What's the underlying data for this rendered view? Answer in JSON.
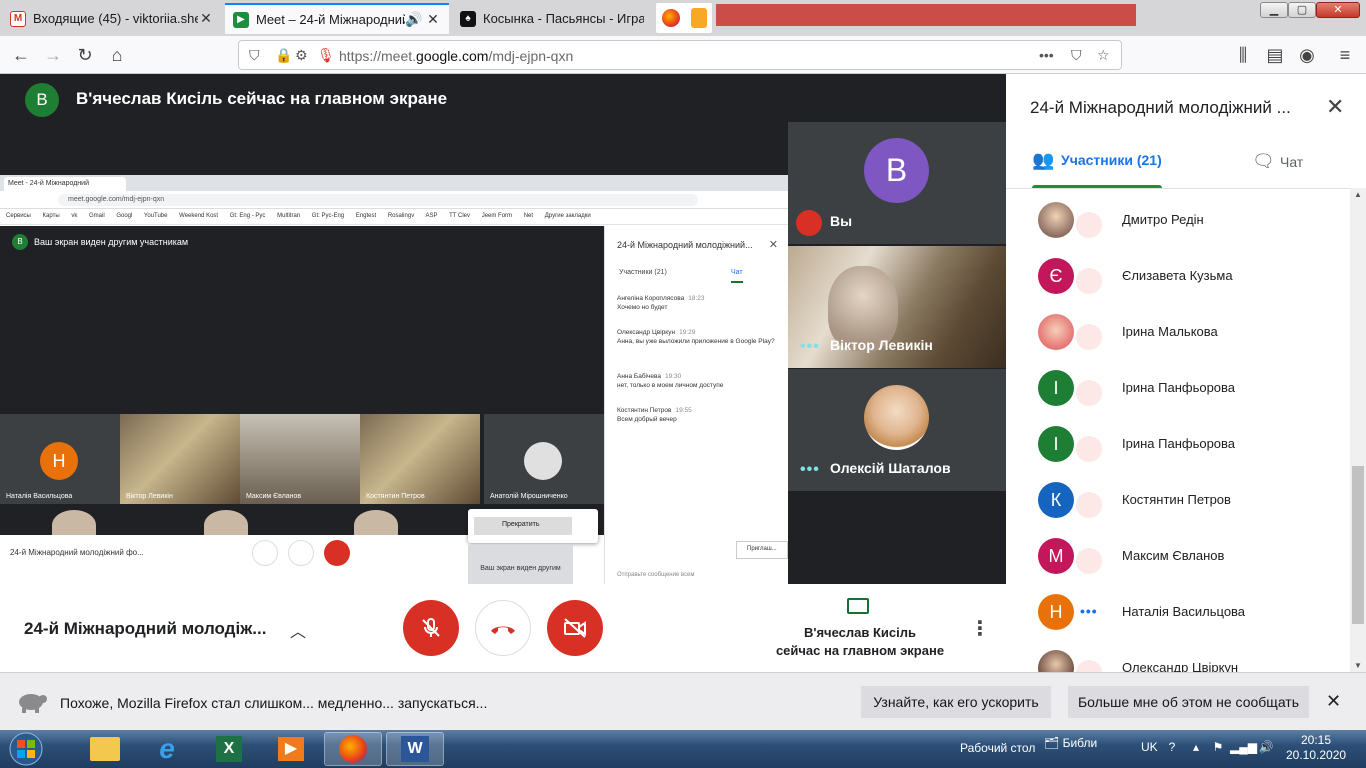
{
  "browser": {
    "tabs": [
      {
        "title": "Входящие (45) - viktoriia.shekh",
        "icon": "gmail-icon",
        "active": false
      },
      {
        "title": "Meet – 24-й Міжнародний",
        "icon": "meet-icon",
        "active": true
      },
      {
        "title": "Косынка - Пасьянсы - Играе",
        "icon": "solitaire-icon",
        "active": false
      }
    ],
    "url_prefix": "https://meet.",
    "url_domain": "google.com",
    "url_path": "/mdj-ejpn-qxn",
    "window_controls": [
      "minimize-icon",
      "maximize-icon",
      "close-icon"
    ]
  },
  "stage": {
    "banner_avatar": "В",
    "banner_text": "В'ячеслав Кисіль сейчас на главном экране"
  },
  "presentation": {
    "tab_title": "Meet - 24-й Міжнародний",
    "url": "meet.google.com/mdj-ejpn-qxn",
    "bookmarks": [
      "Сервисы",
      "Карты",
      "vk",
      "Gmail",
      "Googl",
      "YouTube",
      "Weekend Kost",
      "Gt: Eng - Pyc",
      "Multitran",
      "Gt: Pyc-Eng",
      "Engtest",
      "Rosalingv",
      "ASP",
      "TT Сlev",
      "Jeem Form",
      "Net",
      "Другие закладки"
    ],
    "shared_banner": "Ваш экран виден другим участникам",
    "tiles": [
      {
        "name": "Наталія Васильцова",
        "avatar": "Н"
      },
      {
        "name": "Віктор Левикін",
        "avatar": ""
      },
      {
        "name": "Максим Євланов",
        "avatar": ""
      },
      {
        "name": "Костянтин Петров",
        "avatar": ""
      },
      {
        "name": "Анатолій Мірошниченко",
        "avatar": ""
      }
    ],
    "bottom_title": "24-й Міжнародний молодіжний фо...",
    "stop_label": "Прекратить",
    "shown_label": "Ваш экран виден другим",
    "side_title": "24-й Міжнародний молодіжний...",
    "side_tab_people": "Участники (21)",
    "side_tab_chat": "Чат",
    "messages": [
      {
        "author": "Ангеліна Короплясова",
        "time": "18:23",
        "text": "Хочемо но будет"
      },
      {
        "author": "Олександр Цвіркун",
        "time": "19:29",
        "text": "Анна, вы уже выложили приложение в Google Play?"
      },
      {
        "author": "Анна Бабічева",
        "time": "19:30",
        "text": "нет, только в моем личном доступе"
      },
      {
        "author": "Костянтин Петров",
        "time": "19:55",
        "text": "Всем добрый вечер"
      }
    ],
    "send_placeholder": "Отправьте сообщение всем",
    "notice": "Приглаш..."
  },
  "tiles": [
    {
      "name": "Вы",
      "avatar": "В",
      "color": "#7e57c2"
    },
    {
      "name": "Віктор Левикін",
      "avatar": "",
      "color": ""
    },
    {
      "name": "Олексій Шаталов",
      "avatar": "",
      "color": ""
    }
  ],
  "meetbar": {
    "title": "24-й Міжнародний молодіж...",
    "presenting_line1": "В'ячеслав Кисіль",
    "presenting_line2": "сейчас на главном экране"
  },
  "panel": {
    "title": "24-й Міжнародний молодіжний ...",
    "tab_people": "Участники (21)",
    "tab_chat": "Чат",
    "people": [
      {
        "name": "Дмитро Редін",
        "avatar": "",
        "color": "#8d6e63",
        "state": "muted"
      },
      {
        "name": "Єлизавета Кузьма",
        "avatar": "Є",
        "color": "#c2185b",
        "state": "muted"
      },
      {
        "name": "Ірина Малькова",
        "avatar": "",
        "color": "#e57373",
        "state": "muted"
      },
      {
        "name": "Ірина Панфьорова",
        "avatar": "І",
        "color": "#1e7e34",
        "state": "muted"
      },
      {
        "name": "Ірина Панфьорова",
        "avatar": "І",
        "color": "#1e7e34",
        "state": "muted"
      },
      {
        "name": "Костянтин Петров",
        "avatar": "К",
        "color": "#1565c0",
        "state": "muted"
      },
      {
        "name": "Максим Євланов",
        "avatar": "М",
        "color": "#c2185b",
        "state": "muted"
      },
      {
        "name": "Наталія Васильцова",
        "avatar": "Н",
        "color": "#e8710a",
        "state": "speaking"
      },
      {
        "name": "Олександр Цвіркун",
        "avatar": "",
        "color": "#6d4c41",
        "state": "muted"
      }
    ]
  },
  "notification": {
    "text": "Похоже, Mozilla Firefox стал слишком... медленно... запускаться...",
    "button_learn": "Узнайте, как его ускорить",
    "button_dismiss": "Больше мне об этом не сообщать"
  },
  "taskbar": {
    "apps": [
      "explorer-icon",
      "ie-icon",
      "excel-icon",
      "media-player-icon",
      "firefox-icon",
      "word-icon"
    ],
    "desktop": "Рабочий стол",
    "library": "Библи",
    "lang": "UK",
    "time": "20:15",
    "date": "20.10.2020"
  }
}
